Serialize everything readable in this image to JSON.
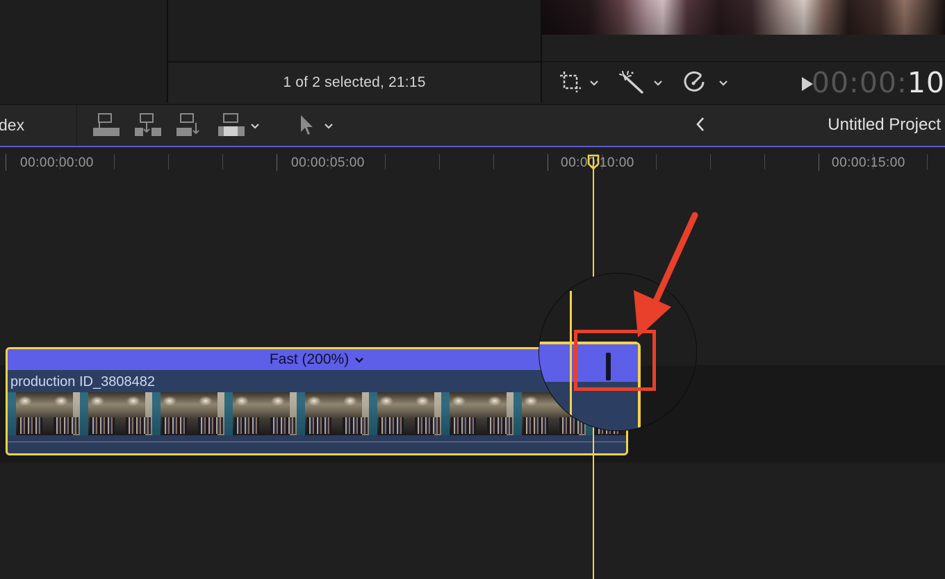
{
  "browser": {
    "status_text": "1 of 2 selected, 21:15"
  },
  "viewer": {
    "timecode_dim": "00:00:",
    "timecode_bright": "10",
    "tools": [
      {
        "icon": "crop-icon"
      },
      {
        "icon": "magic-wand-icon"
      },
      {
        "icon": "speedometer-icon"
      }
    ]
  },
  "timeline_toolbar": {
    "index_label": "Index",
    "index_visible_text": "dex",
    "edit_buttons": [
      "connect-clip-icon",
      "insert-clip-icon",
      "append-clip-icon",
      "overwrite-clip-icon"
    ],
    "tool_icon": "arrow-select-icon",
    "project_title": "Untitled Project"
  },
  "ruler": {
    "labels": [
      "00:00:00:00",
      "00:00:05:00",
      "00:00:10:00",
      "00:00:15:00"
    ]
  },
  "clip": {
    "retime_label": "Fast (200%)",
    "title": "production ID_3808482"
  },
  "colors": {
    "selection": "#f4d24a",
    "retime_bar": "#5d5fe8",
    "highlight": "#e8402a",
    "clip_body": "#2c3f63"
  }
}
